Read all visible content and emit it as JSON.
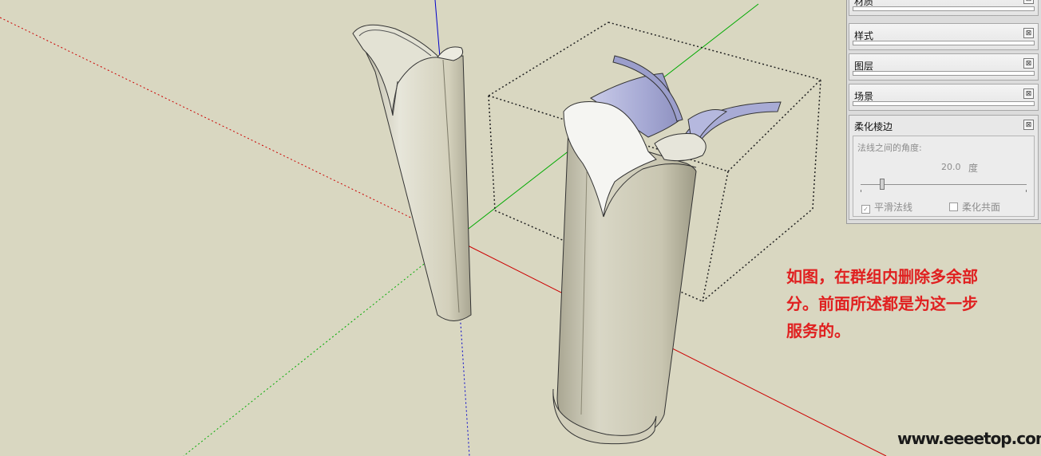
{
  "tray": {
    "panels": [
      {
        "title": "材质"
      },
      {
        "title": "样式"
      },
      {
        "title": "图层"
      },
      {
        "title": "场景"
      }
    ],
    "soften": {
      "title": "柔化棱边",
      "angle_label": "法线之间的角度:",
      "angle_value": "20.0",
      "angle_unit": "度",
      "slider_fraction": 0.1,
      "smooth_normals": {
        "label": "平滑法线",
        "checked": true
      },
      "soften_coplanar": {
        "label": "柔化共面",
        "checked": false
      }
    },
    "close_glyph": "⊠"
  },
  "annotation": {
    "lines": [
      "如图，在群组内删除多余部",
      "分。前面所述都是为这一步",
      "服务的。"
    ]
  },
  "watermark": "www.eeeetop.com",
  "colors": {
    "background": "#d9d7c1",
    "model_face": "#d6d3be",
    "model_light": "#ecebe0",
    "inner_blue": "#a9acd6",
    "axis_red": "#cc0000",
    "axis_green": "#00aa00",
    "axis_blue": "#0000cc",
    "annotation": "#e02020"
  }
}
